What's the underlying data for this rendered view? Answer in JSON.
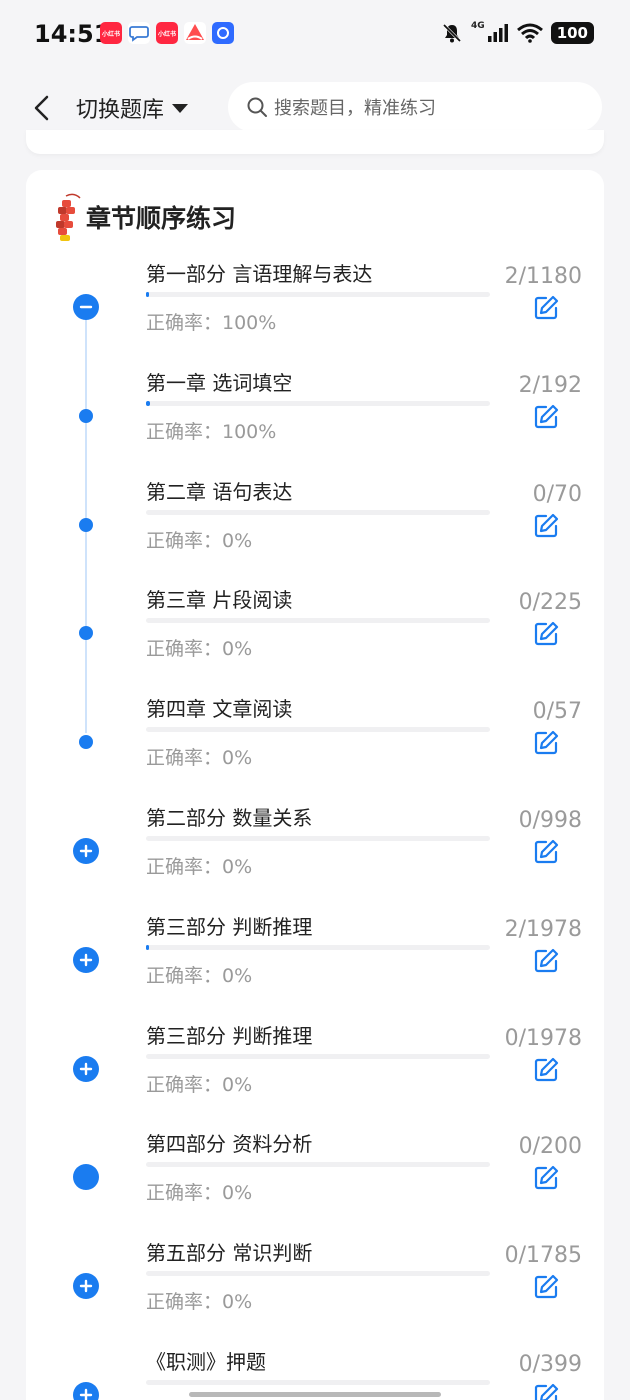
{
  "status_bar": {
    "time": "14:51",
    "network": "4G",
    "battery": "100",
    "icons": [
      "xiaohongshu-icon",
      "chat-icon",
      "xiaohongshu-icon",
      "flame-app-icon",
      "app-icon"
    ]
  },
  "header": {
    "back_icon": "back-chevron-icon",
    "bank_title": "切换题库",
    "search_placeholder": "搜索题目，精准练习"
  },
  "section": {
    "title": "章节顺序练习",
    "icon": "firecracker-icon"
  },
  "rows": [
    {
      "title": "第一部分 言语理解与表达",
      "accuracy": "正确率：100%",
      "count": "2/1180",
      "progress": 0.0017,
      "node": "minus"
    },
    {
      "title": "第一章 选词填空",
      "accuracy": "正确率：100%",
      "count": "2/192",
      "progress": 0.0104,
      "node": "dot"
    },
    {
      "title": "第二章 语句表达",
      "accuracy": "正确率：0%",
      "count": "0/70",
      "progress": 0,
      "node": "dot"
    },
    {
      "title": "第三章 片段阅读",
      "accuracy": "正确率：0%",
      "count": "0/225",
      "progress": 0,
      "node": "dot"
    },
    {
      "title": "第四章 文章阅读",
      "accuracy": "正确率：0%",
      "count": "0/57",
      "progress": 0,
      "node": "dot"
    },
    {
      "title": "第二部分 数量关系",
      "accuracy": "正确率：0%",
      "count": "0/998",
      "progress": 0,
      "node": "plus"
    },
    {
      "title": "第三部分 判断推理",
      "accuracy": "正确率：0%",
      "count": "2/1978",
      "progress": 0.001,
      "node": "plus"
    },
    {
      "title": "第三部分 判断推理",
      "accuracy": "正确率：0%",
      "count": "0/1978",
      "progress": 0,
      "node": "plus"
    },
    {
      "title": "第四部分 资料分析",
      "accuracy": "正确率：0%",
      "count": "0/200",
      "progress": 0,
      "node": "filled"
    },
    {
      "title": "第五部分 常识判断",
      "accuracy": "正确率：0%",
      "count": "0/1785",
      "progress": 0,
      "node": "plus"
    },
    {
      "title": "《职测》押题",
      "accuracy": "",
      "count": "0/399",
      "progress": 0,
      "node": "plus"
    }
  ],
  "colors": {
    "accent": "#1a7cf0",
    "muted_text": "#9a9a9a",
    "track": "#f0f0f2"
  }
}
